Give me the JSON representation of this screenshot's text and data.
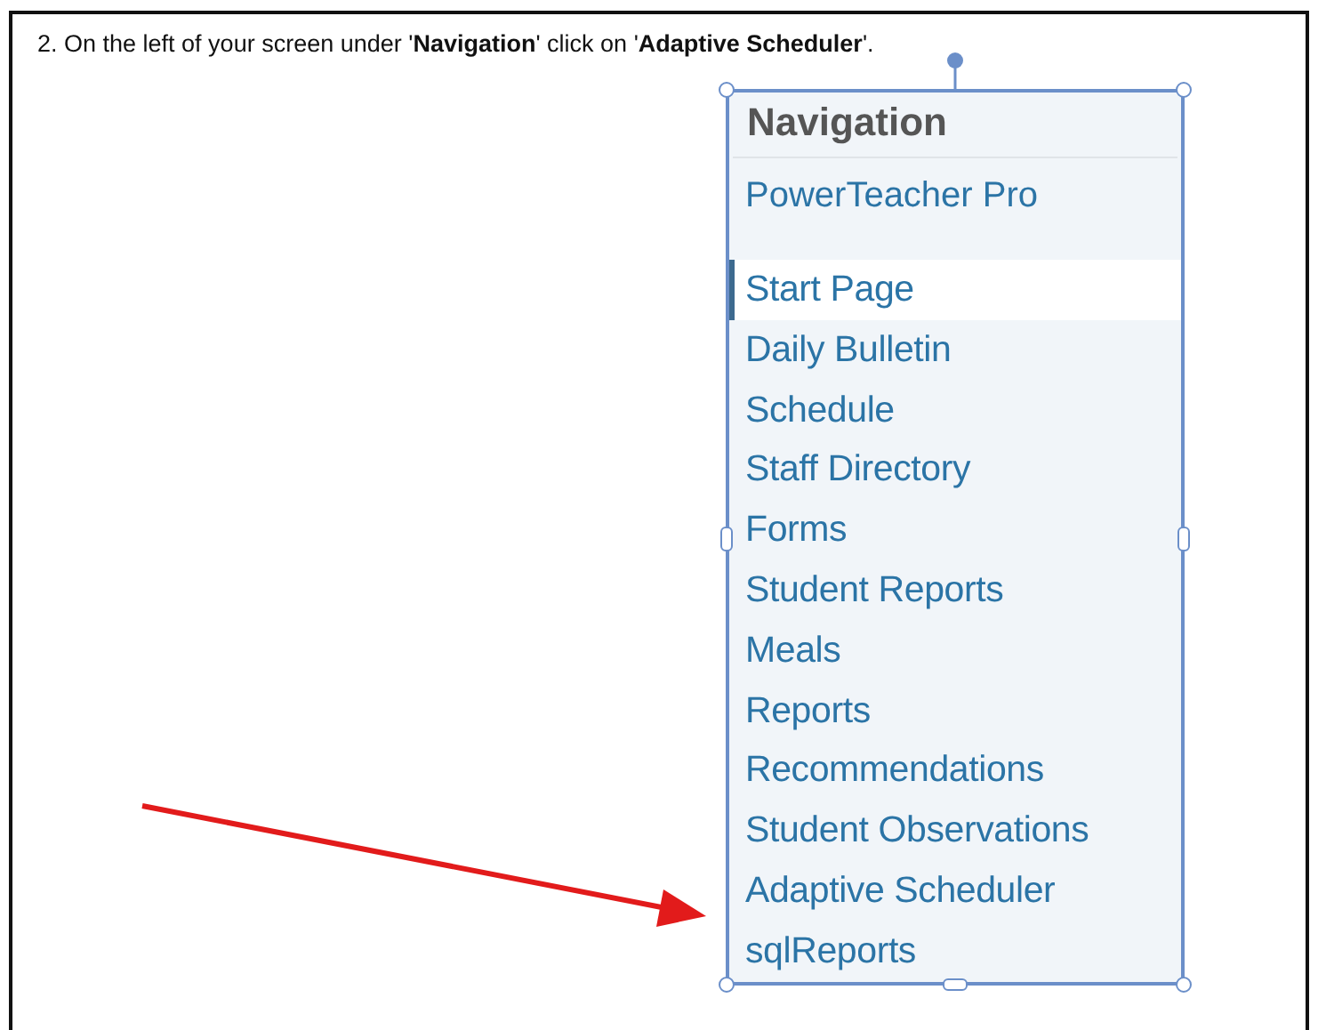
{
  "instruction": "2. On the left of your screen under '**Navigation**' click on '**Adaptive Scheduler**'.",
  "navigation": {
    "title": "Navigation",
    "app_link": "PowerTeacher Pro",
    "items": [
      {
        "label": "Start Page",
        "selected": true
      },
      {
        "label": "Daily Bulletin",
        "selected": false
      },
      {
        "label": "Schedule",
        "selected": false
      },
      {
        "label": "Staff Directory",
        "selected": false
      },
      {
        "label": "Forms",
        "selected": false
      },
      {
        "label": "Student Reports",
        "selected": false
      },
      {
        "label": "Meals",
        "selected": false
      },
      {
        "label": "Reports",
        "selected": false
      },
      {
        "label": "Recommendations",
        "selected": false
      },
      {
        "label": "Student Observations",
        "selected": false
      },
      {
        "label": "Adaptive Scheduler",
        "selected": false
      },
      {
        "label": "sqlReports",
        "selected": false
      }
    ]
  }
}
